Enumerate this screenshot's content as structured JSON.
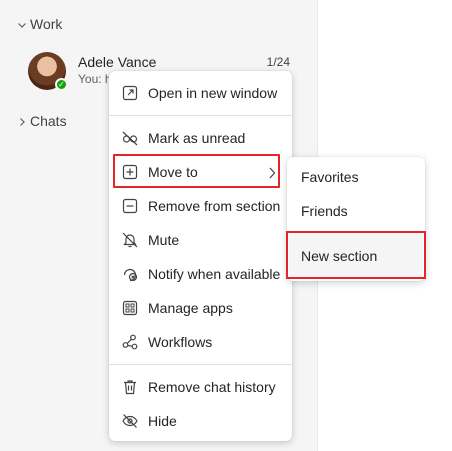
{
  "sidebar": {
    "work_label": "Work",
    "chats_label": "Chats",
    "chat": {
      "name": "Adele Vance",
      "preview": "You: h",
      "time": "1/24",
      "presence": "available"
    }
  },
  "context_menu": {
    "items": [
      {
        "label": "Open in new window",
        "icon": "open-window-icon"
      },
      {
        "label": "Mark as unread",
        "icon": "eye-off-icon"
      },
      {
        "label": "Move to",
        "icon": "plus-square-icon",
        "has_submenu": true,
        "highlighted": true
      },
      {
        "label": "Remove from section",
        "icon": "minus-square-icon"
      },
      {
        "label": "Mute",
        "icon": "bell-off-icon"
      },
      {
        "label": "Notify when available",
        "icon": "notify-icon"
      },
      {
        "label": "Manage apps",
        "icon": "apps-grid-icon"
      },
      {
        "label": "Workflows",
        "icon": "workflows-icon"
      },
      {
        "label": "Remove chat history",
        "icon": "trash-icon"
      },
      {
        "label": "Hide",
        "icon": "hide-icon"
      }
    ]
  },
  "submenu": {
    "items": [
      {
        "label": "Favorites"
      },
      {
        "label": "Friends"
      },
      {
        "label": "New section",
        "highlighted": true
      }
    ]
  },
  "colors": {
    "highlight_border": "#e3252a",
    "presence_available": "#13a10e"
  }
}
